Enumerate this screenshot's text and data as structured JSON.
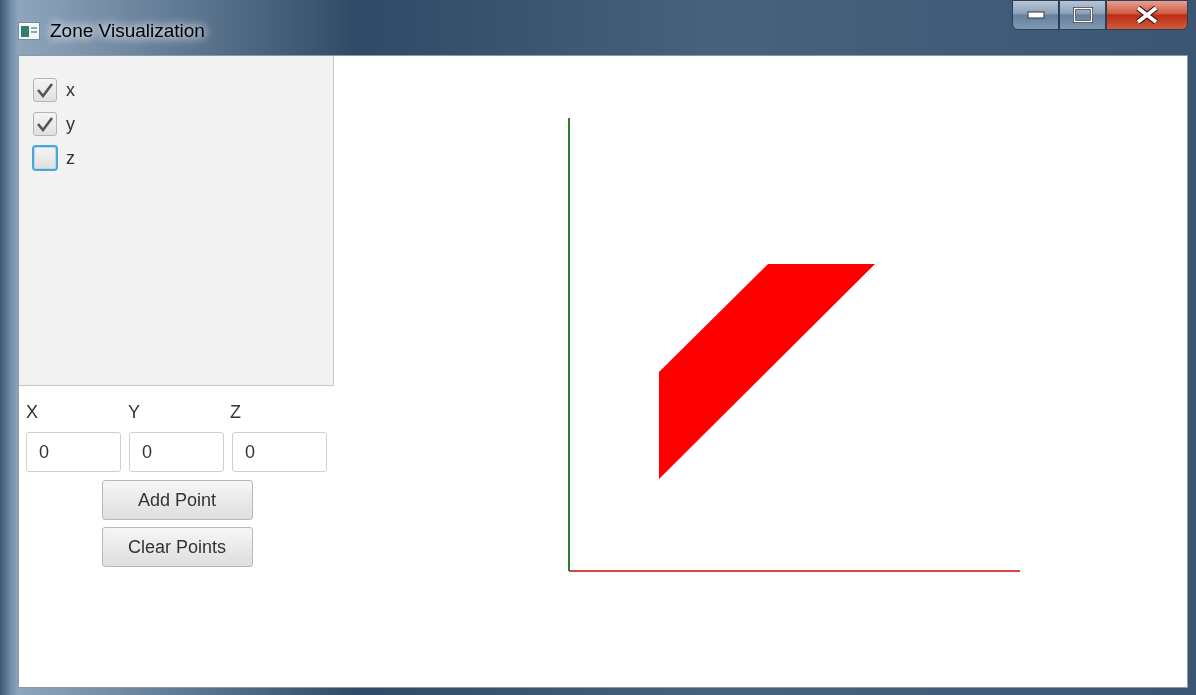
{
  "window": {
    "title": "Zone Visualization"
  },
  "axes": [
    {
      "label": "x",
      "checked": true,
      "focused": false
    },
    {
      "label": "y",
      "checked": true,
      "focused": false
    },
    {
      "label": "z",
      "checked": false,
      "focused": true
    }
  ],
  "point_form": {
    "fields": [
      {
        "label": "X",
        "value": "0"
      },
      {
        "label": "Y",
        "value": "0"
      },
      {
        "label": "Z",
        "value": "0"
      }
    ]
  },
  "buttons": [
    "Add Point",
    "Clear Points"
  ]
}
